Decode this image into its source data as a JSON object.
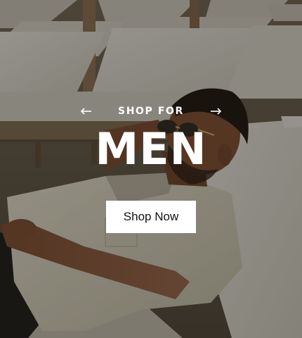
{
  "banner": {
    "eyebrow": "SHOP FOR",
    "headline": "MEN",
    "cta_label": "Shop Now",
    "prev_icon": "arrow-left-icon",
    "next_icon": "arrow-right-icon"
  },
  "colors": {
    "text": "#ffffff",
    "button_bg": "#ffffff",
    "button_text": "#111111",
    "cushion": "#d9d6cc",
    "shirt": "#d7d2c0",
    "skin": "#8a5a3c",
    "sand": "#8a7a63"
  }
}
